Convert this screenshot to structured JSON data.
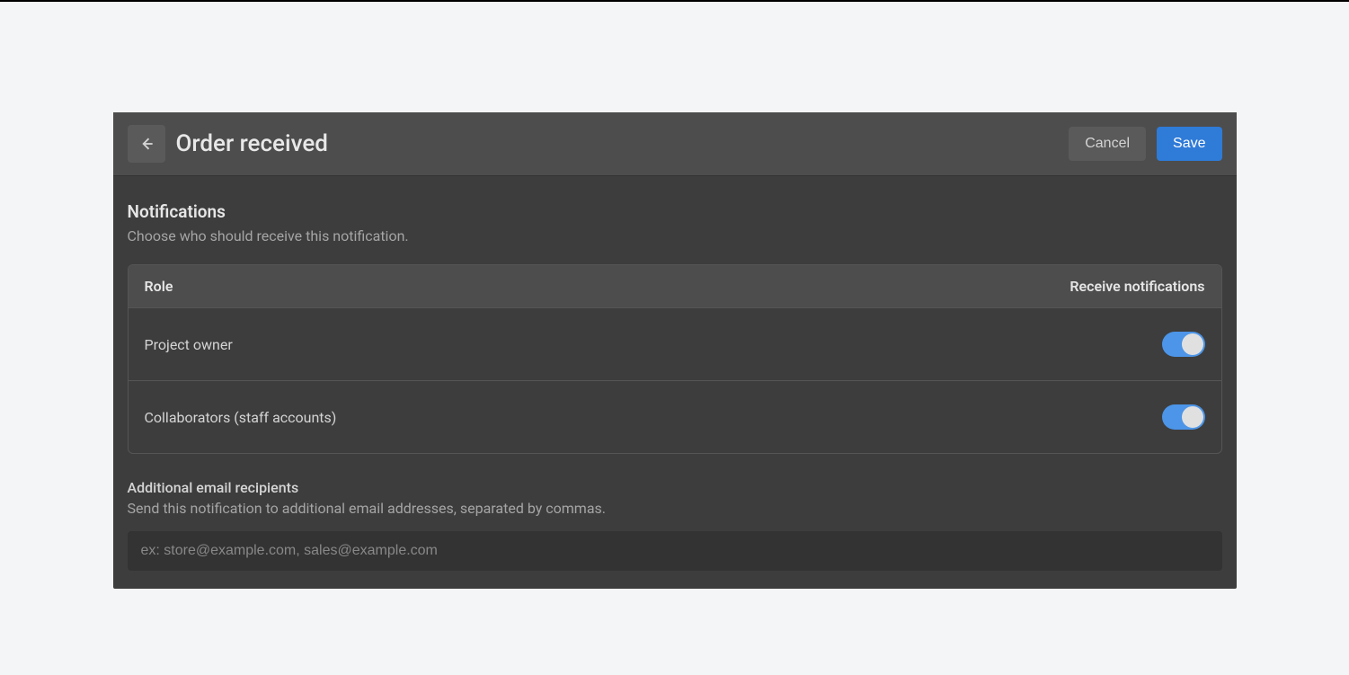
{
  "header": {
    "title": "Order received",
    "cancel_label": "Cancel",
    "save_label": "Save"
  },
  "notifications": {
    "title": "Notifications",
    "description": "Choose who should receive this notification.",
    "table": {
      "role_header": "Role",
      "receive_header": "Receive notifications",
      "rows": [
        {
          "label": "Project owner",
          "enabled": true
        },
        {
          "label": "Collaborators (staff accounts)",
          "enabled": true
        }
      ]
    }
  },
  "additional": {
    "title": "Additional email recipients",
    "description": "Send this notification to additional email addresses, separated by commas.",
    "placeholder": "ex: store@example.com, sales@example.com",
    "value": ""
  },
  "colors": {
    "toggle_on": "#4c95e8",
    "primary_button": "#2f7bd8"
  }
}
